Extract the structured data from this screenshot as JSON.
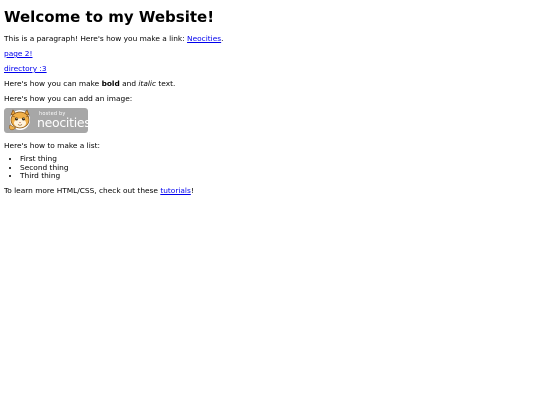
{
  "heading": "Welcome to my Website!",
  "intro": {
    "text": "This is a paragraph! Here's how you make a link: ",
    "link": "Neocities",
    "suffix": "."
  },
  "links": {
    "page2": "page 2!",
    "directory": "directory :3"
  },
  "formatting": {
    "prefix": "Here's how you can make ",
    "bold": "bold",
    "middle": " and ",
    "italic": "italic",
    "suffix": " text."
  },
  "image_intro": "Here's how you can add an image:",
  "badge": {
    "small_text": "hosted by",
    "big_text": "neocities",
    "color": "#a7a7a7"
  },
  "list_intro": "Here's how to make a list:",
  "list_items": [
    "First thing",
    "Second thing",
    "Third thing"
  ],
  "outro": {
    "text": "To learn more HTML/CSS, check out these ",
    "link": "tutorials",
    "suffix": "!"
  },
  "colors": {
    "link": "#0000ee",
    "text": "#000000",
    "background": "#ffffff"
  }
}
